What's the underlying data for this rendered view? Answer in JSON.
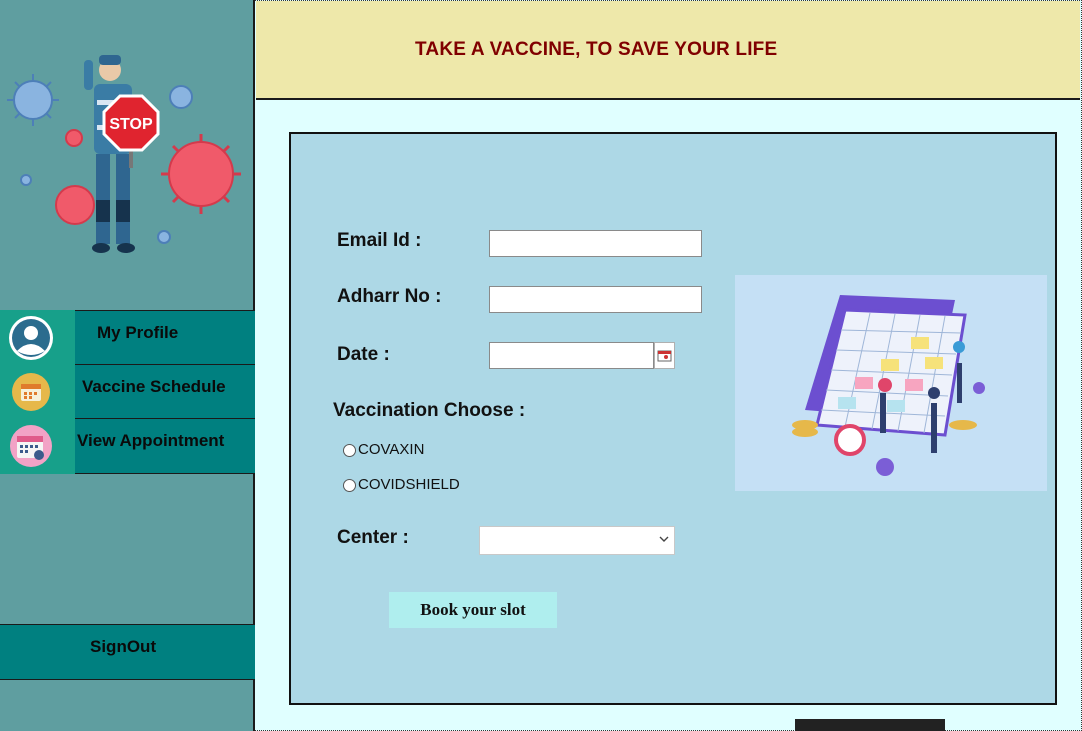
{
  "sidebar": {
    "menu": [
      {
        "label": "My Profile",
        "icon": "user-profile-icon"
      },
      {
        "label": "Vaccine Schedule",
        "icon": "calendar-icon"
      },
      {
        "label": "View Appointment",
        "icon": "appointment-calendar-icon"
      }
    ],
    "signout_label": "SignOut",
    "illustration": {
      "sign_text": "STOP"
    }
  },
  "header": {
    "title": "TAKE A VACCINE, TO SAVE YOUR LIFE"
  },
  "form": {
    "email_label": "Email Id :",
    "email_value": "",
    "adhaar_label": "Adharr No :",
    "adhaar_value": "",
    "date_label": "Date :",
    "date_value": "",
    "vaccination_label": "Vaccination Choose :",
    "vaccine_options": [
      "COVAXIN",
      "COVIDSHIELD"
    ],
    "center_label": "Center :",
    "center_selected": "",
    "submit_label": "Book your slot"
  },
  "colors": {
    "sidebar_bg": "#5f9ea0",
    "menu_bg": "#008080",
    "menu_icon_bg": "#17a08a",
    "header_bg": "#eee8aa",
    "header_text": "#800000",
    "page_bg": "#e0ffff",
    "panel_bg": "#add8e6",
    "button_bg": "#afeeee"
  }
}
